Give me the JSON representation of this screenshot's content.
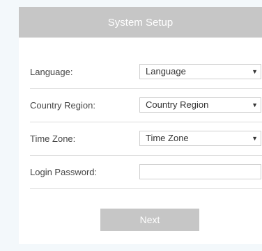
{
  "header": {
    "title": "System Setup"
  },
  "form": {
    "language": {
      "label": "Language:",
      "value": "Language"
    },
    "country_region": {
      "label": "Country Region:",
      "value": "Country Region"
    },
    "time_zone": {
      "label": "Time Zone:",
      "value": "Time Zone"
    },
    "login_password": {
      "label": "Login Password:",
      "value": ""
    }
  },
  "actions": {
    "next_label": "Next"
  },
  "icons": {
    "dropdown": "caret-down-icon"
  },
  "colors": {
    "header_bg": "#c6c6c6",
    "page_bg": "#f3f8fb",
    "button_bg": "#c6c6c6"
  }
}
